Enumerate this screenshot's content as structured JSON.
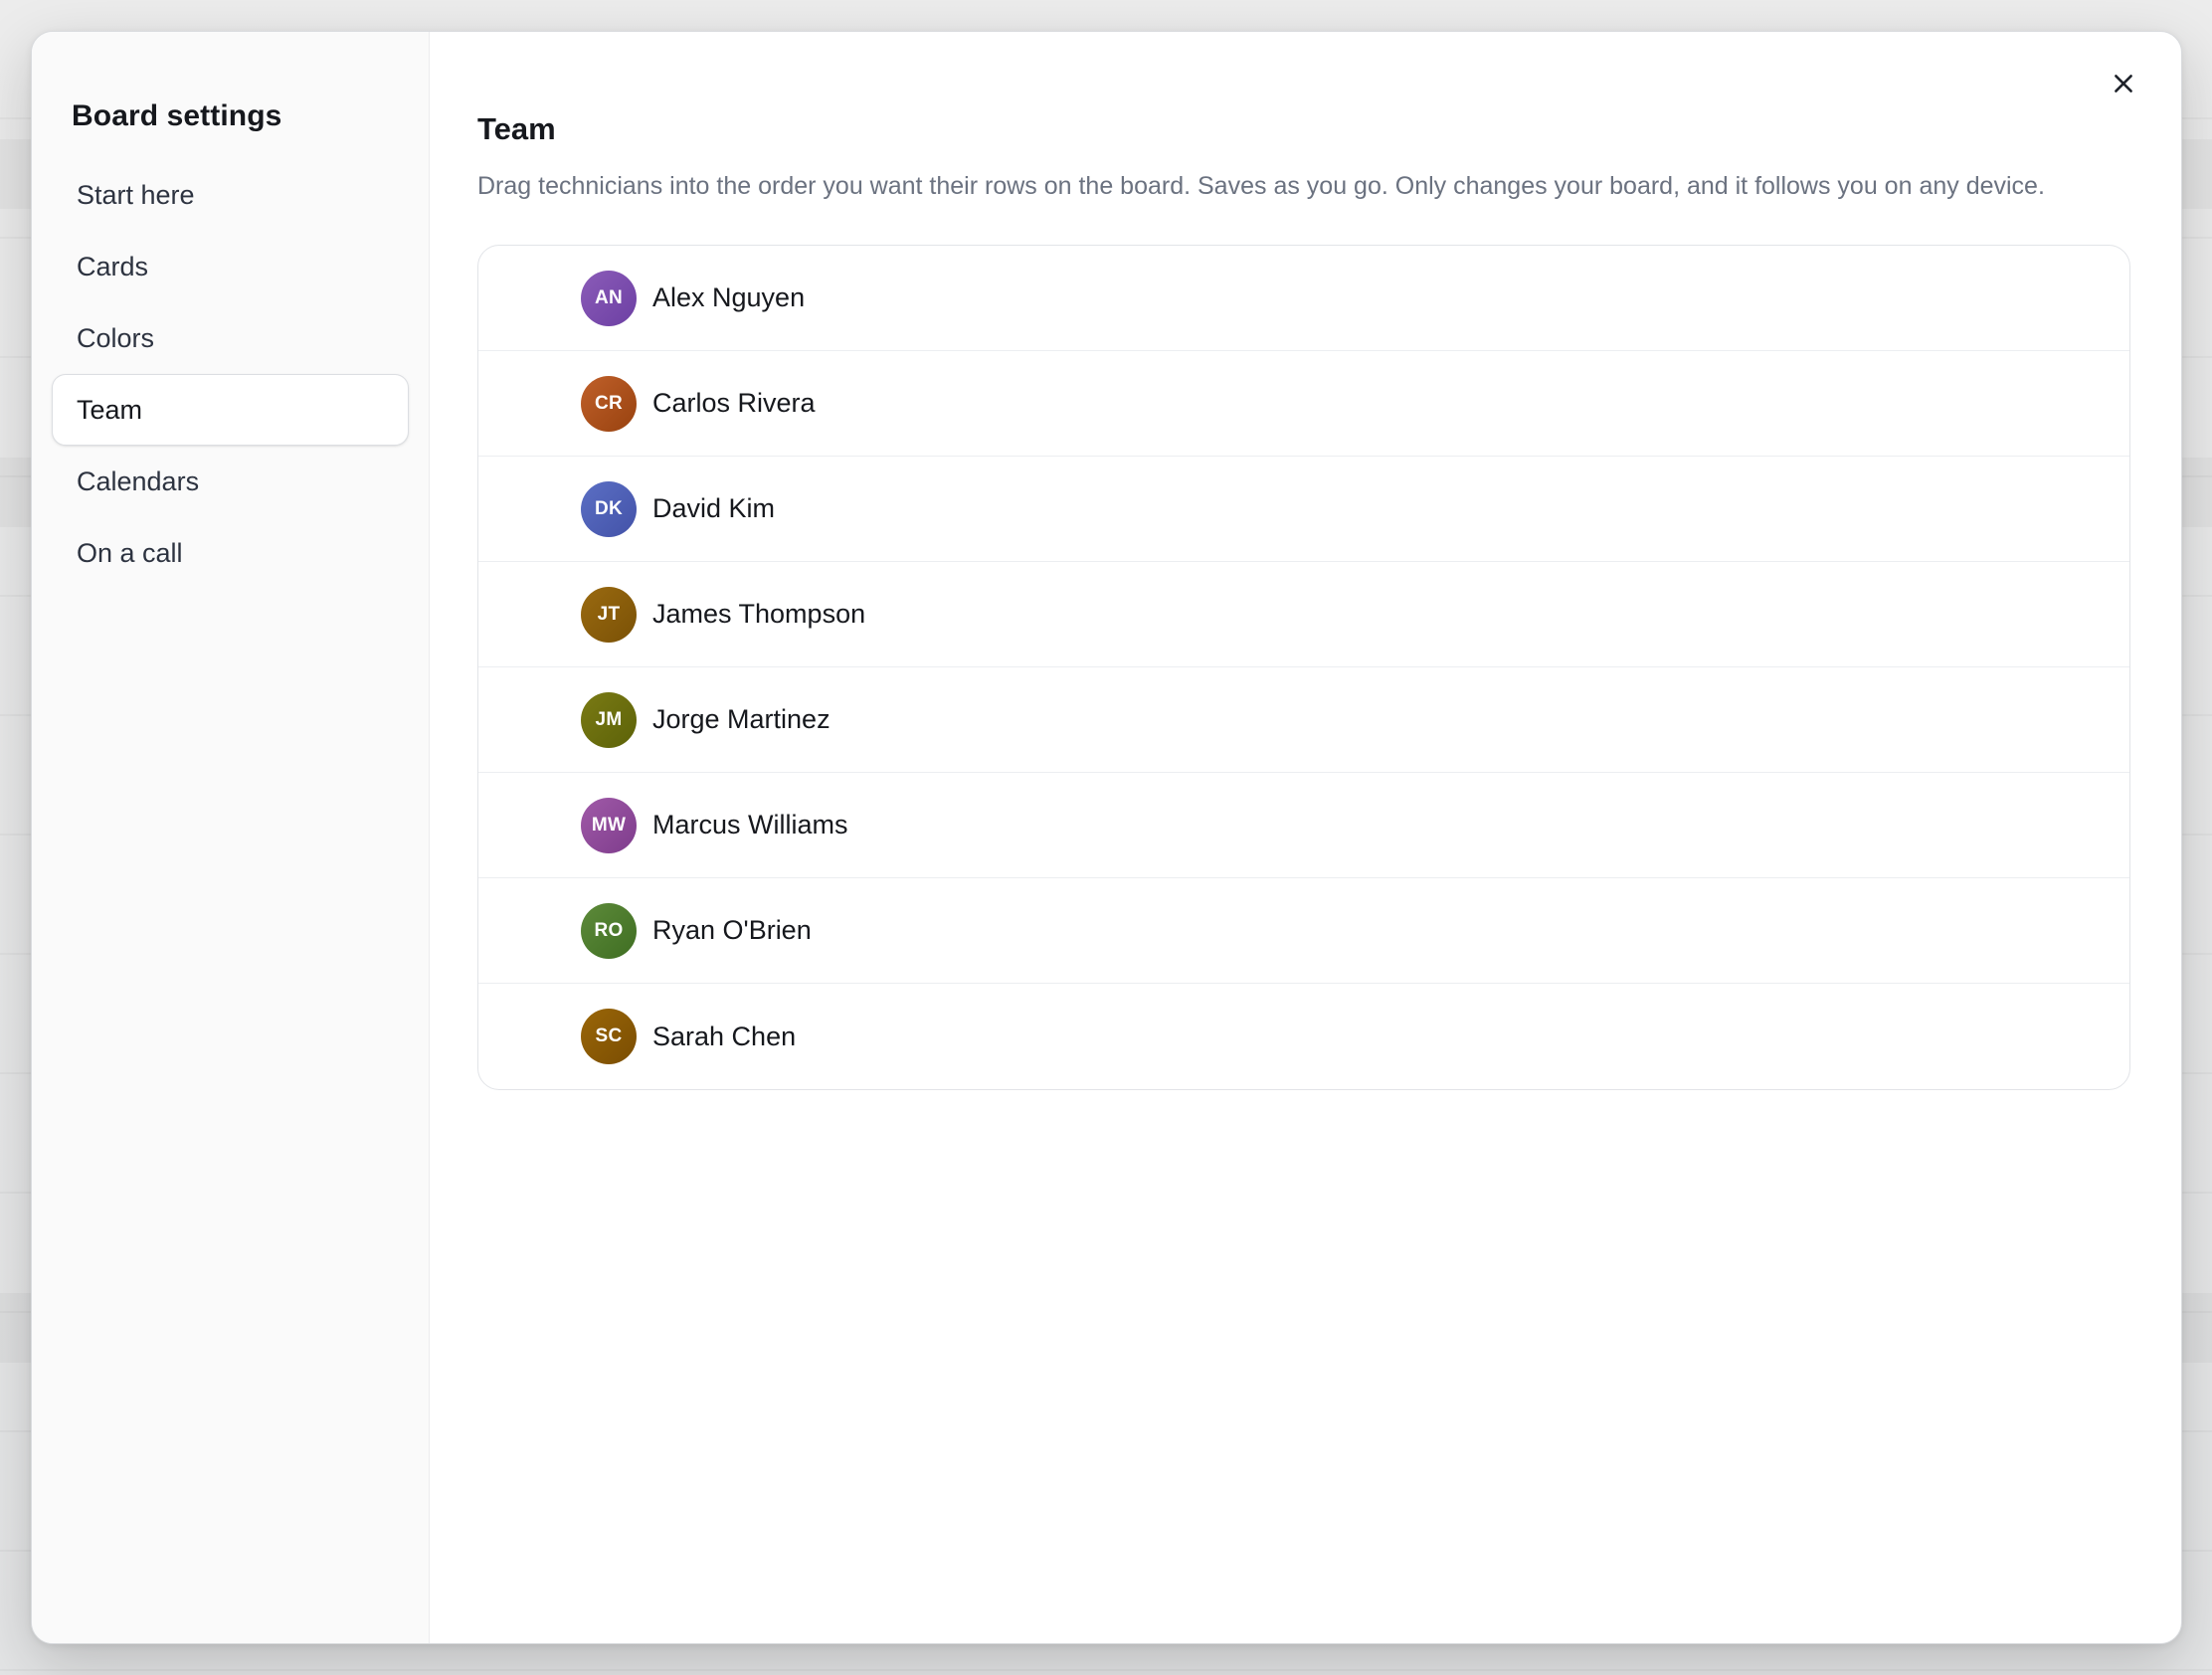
{
  "sidebar": {
    "title": "Board settings",
    "items": [
      {
        "label": "Start here",
        "active": false
      },
      {
        "label": "Cards",
        "active": false
      },
      {
        "label": "Colors",
        "active": false
      },
      {
        "label": "Team",
        "active": true
      },
      {
        "label": "Calendars",
        "active": false
      },
      {
        "label": "On a call",
        "active": false
      }
    ]
  },
  "main": {
    "title": "Team",
    "description": "Drag technicians into the order you want their rows on the board. Saves as you go. Only changes your board, and it follows you on any device.",
    "close_icon": "close-icon",
    "technicians": [
      {
        "name": "Alex Nguyen",
        "initials": "AN",
        "color_from": "#8b5cb8",
        "color_to": "#6c3fa3"
      },
      {
        "name": "Carlos Rivera",
        "initials": "CR",
        "color_from": "#c0602a",
        "color_to": "#98420f"
      },
      {
        "name": "David Kim",
        "initials": "DK",
        "color_from": "#5b6fc4",
        "color_to": "#4352a8"
      },
      {
        "name": "James Thompson",
        "initials": "JT",
        "color_from": "#9a6a10",
        "color_to": "#7a5106"
      },
      {
        "name": "Jorge Martinez",
        "initials": "JM",
        "color_from": "#7a7a14",
        "color_to": "#5c6208"
      },
      {
        "name": "Marcus Williams",
        "initials": "MW",
        "color_from": "#a05aa8",
        "color_to": "#7e3c8c"
      },
      {
        "name": "Ryan O'Brien",
        "initials": "RO",
        "color_from": "#5d8a3a",
        "color_to": "#3f6e22"
      },
      {
        "name": "Sarah Chen",
        "initials": "SC",
        "color_from": "#9a6608",
        "color_to": "#7a4d02"
      }
    ]
  }
}
